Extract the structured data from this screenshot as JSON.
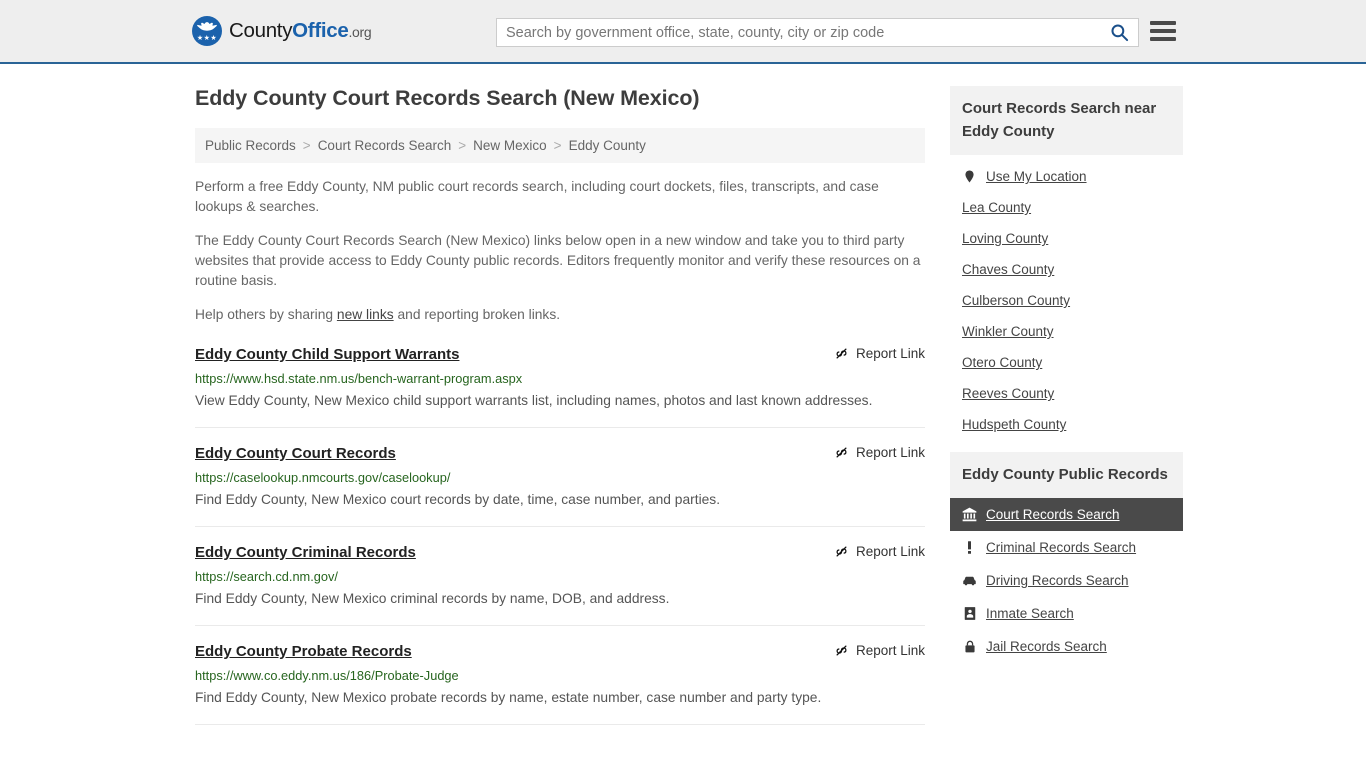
{
  "header": {
    "logo": {
      "name_part1": "County",
      "name_part2": "Office",
      "name_suffix": ".org",
      "icon": "eagle-shield-icon",
      "stars": "★★★",
      "brand_color": "#1b62ac"
    },
    "search": {
      "placeholder": "Search by government office, state, county, city or zip code",
      "value": "",
      "search_icon": "search-icon"
    },
    "menu_icon": "hamburger-menu-icon",
    "border_color": "#2a6496",
    "background": "#eeeeee"
  },
  "main": {
    "title": "Eddy County Court Records Search (New Mexico)",
    "breadcrumb": [
      {
        "label": "Public Records"
      },
      {
        "label": "Court Records Search"
      },
      {
        "label": "New Mexico"
      },
      {
        "label": "Eddy County"
      }
    ],
    "breadcrumb_separator": ">",
    "intro_paragraph_1": "Perform a free Eddy County, NM public court records search, including court dockets, files, transcripts, and case lookups & searches.",
    "intro_paragraph_2": "The Eddy County Court Records Search (New Mexico) links below open in a new window and take you to third party websites that provide access to Eddy County public records. Editors frequently monitor and verify these resources on a routine basis.",
    "intro_paragraph_3_before": "Help others by sharing ",
    "intro_paragraph_3_link": "new links",
    "intro_paragraph_3_after": " and reporting broken links.",
    "report_link_label": "Report Link",
    "report_link_icon": "broken-link-icon",
    "url_color": "#27651f",
    "results": [
      {
        "title": "Eddy County Child Support Warrants",
        "url": "https://www.hsd.state.nm.us/bench-warrant-program.aspx",
        "description": "View Eddy County, New Mexico child support warrants list, including names, photos and last known addresses."
      },
      {
        "title": "Eddy County Court Records",
        "url": "https://caselookup.nmcourts.gov/caselookup/",
        "description": "Find Eddy County, New Mexico court records by date, time, case number, and parties."
      },
      {
        "title": "Eddy County Criminal Records",
        "url": "https://search.cd.nm.gov/",
        "description": "Find Eddy County, New Mexico criminal records by name, DOB, and address."
      },
      {
        "title": "Eddy County Probate Records",
        "url": "https://www.co.eddy.nm.us/186/Probate-Judge",
        "description": "Find Eddy County, New Mexico probate records by name, estate number, case number and party type."
      }
    ]
  },
  "sidebar": {
    "nearby": {
      "heading": "Court Records Search near Eddy County",
      "use_my_location": {
        "label": "Use My Location",
        "icon": "map-pin-icon"
      },
      "counties": [
        {
          "label": "Lea County"
        },
        {
          "label": "Loving County"
        },
        {
          "label": "Chaves County"
        },
        {
          "label": "Culberson County"
        },
        {
          "label": "Winkler County"
        },
        {
          "label": "Otero County"
        },
        {
          "label": "Reeves County"
        },
        {
          "label": "Hudspeth County"
        }
      ]
    },
    "public_records": {
      "heading": "Eddy County Public Records",
      "active_background": "#4a4a4a",
      "items": [
        {
          "label": "Court Records Search",
          "icon": "bank-icon",
          "active": true
        },
        {
          "label": "Criminal Records Search",
          "icon": "exclamation-icon",
          "active": false
        },
        {
          "label": "Driving Records Search",
          "icon": "car-icon",
          "active": false
        },
        {
          "label": "Inmate Search",
          "icon": "id-card-icon",
          "active": false
        },
        {
          "label": "Jail Records Search",
          "icon": "lock-icon",
          "active": false
        }
      ]
    }
  }
}
